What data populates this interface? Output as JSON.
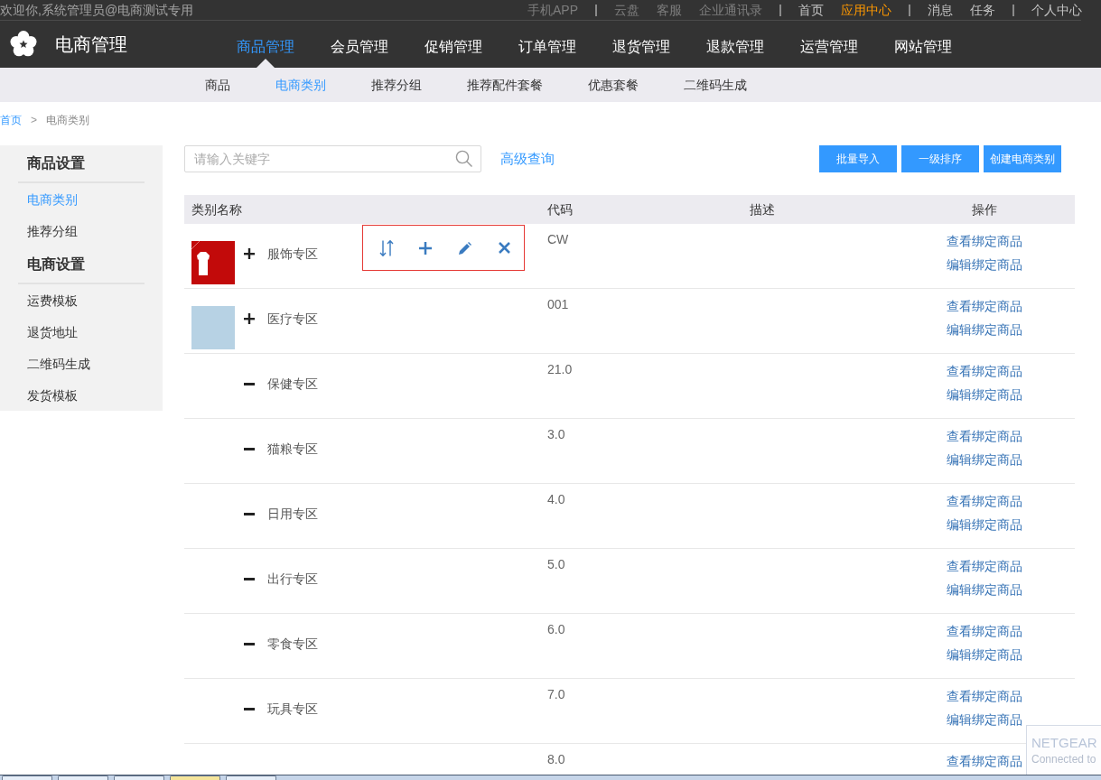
{
  "top_bar": {
    "welcome": "欢迎你,系统管理员@电商测试专用",
    "groups": [
      {
        "links": [
          {
            "label": "手机APP",
            "disabled": true,
            "selected": false
          }
        ]
      },
      {
        "links": [
          {
            "label": "云盘",
            "disabled": true,
            "selected": false
          },
          {
            "label": "客服",
            "disabled": true,
            "selected": false
          },
          {
            "label": "企业通讯录",
            "disabled": true,
            "selected": false
          }
        ]
      },
      {
        "links": [
          {
            "label": "首页",
            "disabled": false,
            "selected": false
          },
          {
            "label": "应用中心",
            "disabled": false,
            "selected": true
          }
        ]
      },
      {
        "links": [
          {
            "label": "消息",
            "disabled": false,
            "selected": false
          },
          {
            "label": "任务",
            "disabled": false,
            "selected": false
          }
        ]
      },
      {
        "links": [
          {
            "label": "个人中心",
            "disabled": false,
            "selected": false
          }
        ]
      }
    ]
  },
  "header": {
    "title": "电商管理",
    "nav": [
      {
        "label": "商品管理",
        "selected": true
      },
      {
        "label": "会员管理",
        "selected": false
      },
      {
        "label": "促销管理",
        "selected": false
      },
      {
        "label": "订单管理",
        "selected": false
      },
      {
        "label": "退货管理",
        "selected": false
      },
      {
        "label": "退款管理",
        "selected": false
      },
      {
        "label": "运营管理",
        "selected": false
      },
      {
        "label": "网站管理",
        "selected": false
      }
    ]
  },
  "sub_nav": [
    {
      "label": "商品",
      "selected": false
    },
    {
      "label": "电商类别",
      "selected": true
    },
    {
      "label": "推荐分组",
      "selected": false
    },
    {
      "label": "推荐配件套餐",
      "selected": false
    },
    {
      "label": "优惠套餐",
      "selected": false
    },
    {
      "label": "二维码生成",
      "selected": false
    }
  ],
  "breadcrumb": [
    {
      "label": "首页",
      "kind": "link"
    },
    {
      "label": ">",
      "kind": "separator"
    },
    {
      "label": "电商类别",
      "kind": "current"
    }
  ],
  "sidebar": {
    "groups": [
      {
        "heading": "商品设置",
        "items": [
          {
            "label": "电商类别",
            "selected": true
          },
          {
            "label": "推荐分组",
            "selected": false
          }
        ]
      },
      {
        "heading": "电商设置",
        "items": [
          {
            "label": "运费模板",
            "selected": false
          },
          {
            "label": "退货地址",
            "selected": false
          },
          {
            "label": "二维码生成",
            "selected": false
          },
          {
            "label": "发货模板",
            "selected": false
          }
        ]
      }
    ]
  },
  "search": {
    "placeholder": "请输入关键字"
  },
  "advanced_search": "高级查询",
  "buttons": [
    "批量导入",
    "一级排序",
    "创建电商类别"
  ],
  "table": {
    "columns": [
      "类别名称",
      "代码",
      "描述",
      "操作"
    ],
    "rows": [
      {
        "thumbnail": {
          "kind": "clothing"
        },
        "expanded": false,
        "name": "服饰专区",
        "code": "CW",
        "hovered": true,
        "links": [
          "查看绑定商品",
          "编辑绑定商品"
        ]
      },
      {
        "thumbnail": {
          "kind": "photo"
        },
        "expanded": false,
        "name": "医疗专区",
        "code": "001",
        "hovered": false,
        "links": [
          "查看绑定商品",
          "编辑绑定商品"
        ]
      },
      {
        "expanded": true,
        "name": "保健专区",
        "code": "21.0",
        "hovered": false,
        "links": [
          "查看绑定商品",
          "编辑绑定商品"
        ]
      },
      {
        "expanded": true,
        "name": "猫粮专区",
        "code": "3.0",
        "hovered": false,
        "links": [
          "查看绑定商品",
          "编辑绑定商品"
        ]
      },
      {
        "expanded": true,
        "name": "日用专区",
        "code": "4.0",
        "hovered": false,
        "links": [
          "查看绑定商品",
          "编辑绑定商品"
        ]
      },
      {
        "expanded": true,
        "name": "出行专区",
        "code": "5.0",
        "hovered": false,
        "links": [
          "查看绑定商品",
          "编辑绑定商品"
        ]
      },
      {
        "expanded": true,
        "name": "零食专区",
        "code": "6.0",
        "hovered": false,
        "links": [
          "查看绑定商品",
          "编辑绑定商品"
        ]
      },
      {
        "expanded": true,
        "name": "玩具专区",
        "code": "7.0",
        "hovered": false,
        "links": [
          "查看绑定商品",
          "编辑绑定商品"
        ]
      },
      {
        "code": "8.0",
        "hovered": false,
        "links": [
          "查看绑定商品"
        ]
      }
    ]
  },
  "notification": {
    "title": "NETGEAR",
    "text": "Connected to"
  },
  "taskbar": {
    "buttons": [
      {
        "selected": false
      },
      {
        "selected": false
      },
      {
        "selected": false
      },
      {
        "selected": true
      },
      {
        "selected": false
      }
    ]
  }
}
